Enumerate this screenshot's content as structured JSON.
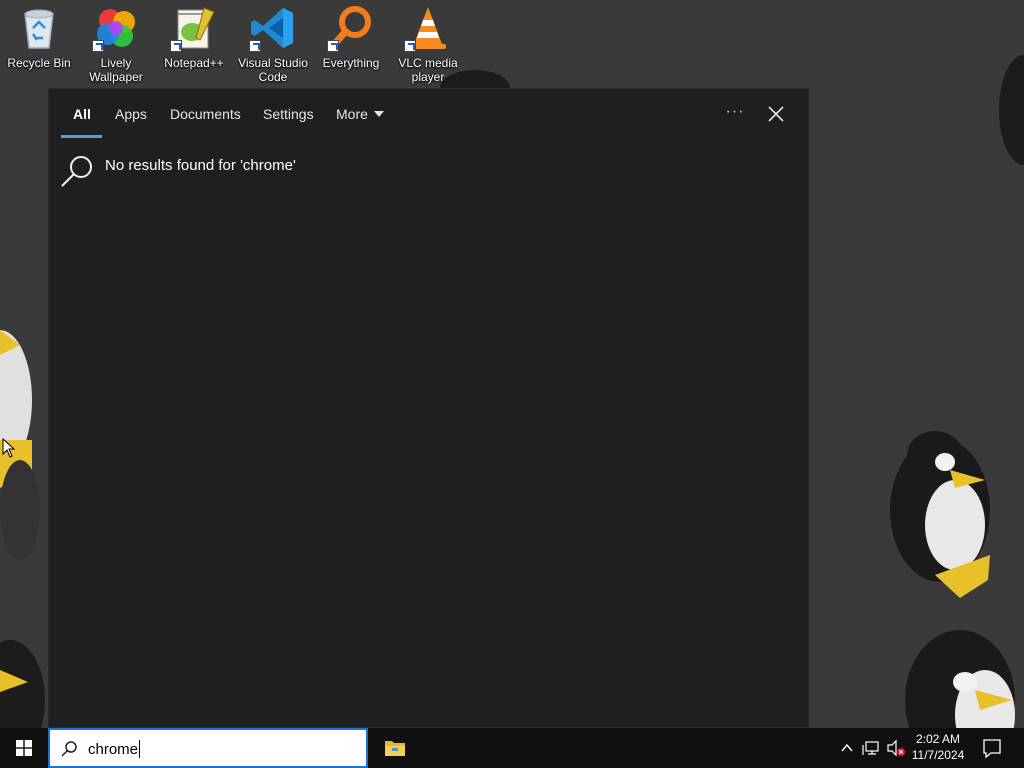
{
  "desktop": {
    "icons": [
      {
        "label": "Recycle Bin",
        "icon": "recycle-bin-icon"
      },
      {
        "label": "Lively Wallpaper",
        "icon": "lively-wallpaper-icon"
      },
      {
        "label": "Notepad++",
        "icon": "notepadpp-icon"
      },
      {
        "label": "Visual Studio Code",
        "icon": "vscode-icon"
      },
      {
        "label": "Everything",
        "icon": "everything-icon"
      },
      {
        "label": "VLC media player",
        "icon": "vlc-icon"
      }
    ]
  },
  "search_panel": {
    "tabs": [
      {
        "label": "All",
        "active": true
      },
      {
        "label": "Apps"
      },
      {
        "label": "Documents"
      },
      {
        "label": "Settings"
      },
      {
        "label": "More"
      }
    ],
    "ellipsis": "···",
    "result_message": "No results found for 'chrome'"
  },
  "taskbar": {
    "search": {
      "value": "chrome"
    },
    "clock": {
      "time": "2:02 AM",
      "date": "11/7/2024"
    }
  },
  "colors": {
    "accent": "#4aa3e8",
    "panel_bg": "#1f1f1f",
    "taskbar_bg": "#101010"
  }
}
